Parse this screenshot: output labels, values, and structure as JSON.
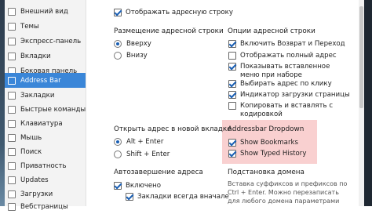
{
  "sidebar": {
    "items": [
      {
        "label": "Внешний вид"
      },
      {
        "label": "Темы"
      },
      {
        "label": "Экспресс-панель"
      },
      {
        "label": "Вкладки"
      },
      {
        "label": "Боковая панель"
      },
      {
        "label": "Address Bar"
      },
      {
        "label": "Закладки"
      },
      {
        "label": "Быстрые команды"
      },
      {
        "label": "Клавиатура"
      },
      {
        "label": "Мышь"
      },
      {
        "label": "Поиск"
      },
      {
        "label": "Приватность"
      },
      {
        "label": "Updates"
      },
      {
        "label": "Загрузки"
      },
      {
        "label": "Вебстраницы"
      }
    ]
  },
  "main": {
    "show_address_bar": {
      "label": "Отображать адресную строку",
      "checked": true
    },
    "placement": {
      "title": "Размещение адресной строки",
      "options": [
        {
          "label": "Вверху",
          "selected": true
        },
        {
          "label": "Внизу",
          "selected": false
        }
      ]
    },
    "address_options": {
      "title": "Опции адресной строки",
      "items": [
        {
          "label": "Включить Возврат и Переход",
          "checked": true
        },
        {
          "label": "Отображать полный адрес",
          "checked": false
        },
        {
          "label": "Показывать вставленное",
          "checked": true
        },
        {
          "label": "меню при наборе",
          "checked": null
        },
        {
          "label": "Выбирать адрес по клику",
          "checked": true
        },
        {
          "label": "Индикатор загрузки страницы",
          "checked": true
        },
        {
          "label": "Копировать и вставлять с",
          "checked": false
        },
        {
          "label": "кодировкой",
          "checked": null
        }
      ]
    },
    "open_new_tab": {
      "title": "Открыть адрес в новой вкладке",
      "options": [
        {
          "label": "Alt + Enter",
          "selected": true
        },
        {
          "label": "Shift + Enter",
          "selected": false
        }
      ]
    },
    "dropdown": {
      "title": "Addressbar Dropdown",
      "items": [
        {
          "label": "Show Bookmarks",
          "checked": true
        },
        {
          "label": "Show Typed History",
          "checked": true
        }
      ]
    },
    "autocomplete": {
      "title": "Автозавершение адреса",
      "items": [
        {
          "label": "Включено",
          "checked": true
        },
        {
          "label": "Закладки всегда вначале",
          "checked": true
        }
      ]
    },
    "domain": {
      "title": "Подстановка домена",
      "desc1": "Вставка суффиксов и префиксов по",
      "desc2": "Ctrl + Enter. Можно перезаписать",
      "desc3": "для любого домена параметрами"
    }
  }
}
